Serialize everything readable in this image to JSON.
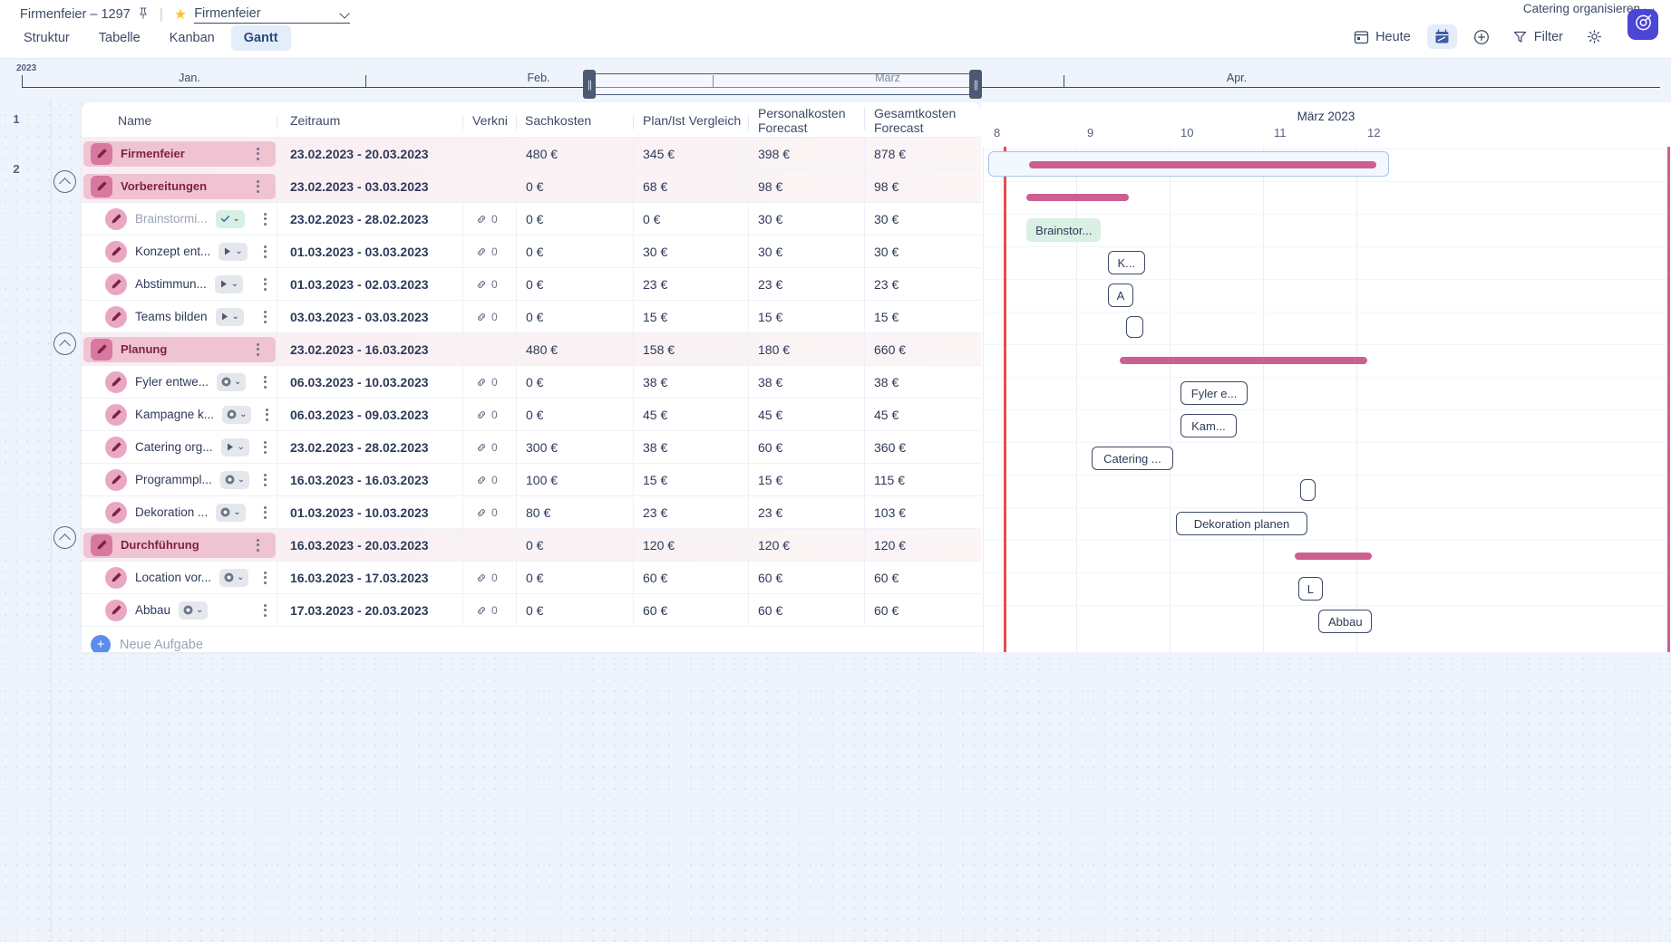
{
  "header": {
    "breadcrumb_project": "Firmenfeier – 1297",
    "pin_icon": "pin-icon",
    "star_icon": "star-icon",
    "project_name": "Firmenfeier",
    "assignee": "Catering organisieren",
    "logo_icon": "target-logo-icon"
  },
  "tabs": [
    {
      "label": "Struktur",
      "active": false
    },
    {
      "label": "Tabelle",
      "active": false
    },
    {
      "label": "Kanban",
      "active": false
    },
    {
      "label": "Gantt",
      "active": true
    }
  ],
  "toolbar": {
    "today_label": "Heute",
    "today_icon": "calendar-icon",
    "calendar_toggle_icon": "calendar-range-icon",
    "add_icon": "plus-circle-icon",
    "filter_label": "Filter",
    "filter_icon": "funnel-icon",
    "settings_icon": "gear-icon"
  },
  "timeline_band": {
    "year": "2023",
    "months": [
      "Jan.",
      "Feb.",
      "März",
      "Apr."
    ],
    "handle_icon": "drag-handle-icon"
  },
  "gutter_numbers": [
    "1",
    "2"
  ],
  "table": {
    "columns": [
      "Name",
      "Zeitraum",
      "Verkni",
      "Sachkosten",
      "Plan/Ist Vergleich",
      "Personalkosten Forecast",
      "Gesamtkosten Forecast"
    ],
    "rows": [
      {
        "name": "Firmenfeier",
        "type": "group",
        "indent": 0,
        "status": null,
        "period": "23.02.2023 - 20.03.2023",
        "links": "",
        "sach": "480 €",
        "plan": "345 €",
        "pers": "398 €",
        "ges": "878 €"
      },
      {
        "name": "Vorbereitungen",
        "type": "group",
        "indent": 0,
        "status": null,
        "period": "23.02.2023 - 03.03.2023",
        "links": "",
        "sach": "0 €",
        "plan": "68 €",
        "pers": "98 €",
        "ges": "98 €"
      },
      {
        "name": "Brainstormi...",
        "type": "task",
        "indent": 1,
        "status": "done",
        "period": "23.02.2023 - 28.02.2023",
        "links": "0",
        "sach": "0 €",
        "plan": "0 €",
        "pers": "30 €",
        "ges": "30 €"
      },
      {
        "name": "Konzept ent...",
        "type": "task",
        "indent": 1,
        "status": "play",
        "period": "01.03.2023 - 03.03.2023",
        "links": "0",
        "sach": "0 €",
        "plan": "30 €",
        "pers": "30 €",
        "ges": "30 €"
      },
      {
        "name": "Abstimmun...",
        "type": "task",
        "indent": 1,
        "status": "play",
        "period": "01.03.2023 - 02.03.2023",
        "links": "0",
        "sach": "0 €",
        "plan": "23 €",
        "pers": "23 €",
        "ges": "23 €"
      },
      {
        "name": "Teams bilden",
        "type": "task",
        "indent": 1,
        "status": "play",
        "period": "03.03.2023 - 03.03.2023",
        "links": "0",
        "sach": "0 €",
        "plan": "15 €",
        "pers": "15 €",
        "ges": "15 €"
      },
      {
        "name": "Planung",
        "type": "group",
        "indent": 0,
        "status": null,
        "period": "23.02.2023 - 16.03.2023",
        "links": "",
        "sach": "480 €",
        "plan": "158 €",
        "pers": "180 €",
        "ges": "660 €"
      },
      {
        "name": "Fyler entwe...",
        "type": "task",
        "indent": 1,
        "status": "dot",
        "period": "06.03.2023 - 10.03.2023",
        "links": "0",
        "sach": "0 €",
        "plan": "38 €",
        "pers": "38 €",
        "ges": "38 €"
      },
      {
        "name": "Kampagne k...",
        "type": "task",
        "indent": 1,
        "status": "dot",
        "period": "06.03.2023 - 09.03.2023",
        "links": "0",
        "sach": "0 €",
        "plan": "45 €",
        "pers": "45 €",
        "ges": "45 €"
      },
      {
        "name": "Catering org...",
        "type": "task",
        "indent": 1,
        "status": "play",
        "period": "23.02.2023 - 28.02.2023",
        "links": "0",
        "sach": "300 €",
        "plan": "38 €",
        "pers": "60 €",
        "ges": "360 €"
      },
      {
        "name": "Programmpl...",
        "type": "task",
        "indent": 1,
        "status": "dot",
        "period": "16.03.2023 - 16.03.2023",
        "links": "0",
        "sach": "100 €",
        "plan": "15 €",
        "pers": "15 €",
        "ges": "115 €"
      },
      {
        "name": "Dekoration ...",
        "type": "task",
        "indent": 1,
        "status": "dot",
        "period": "01.03.2023 - 10.03.2023",
        "links": "0",
        "sach": "80 €",
        "plan": "23 €",
        "pers": "23 €",
        "ges": "103 €"
      },
      {
        "name": "Durchführung",
        "type": "group",
        "indent": 0,
        "status": null,
        "period": "16.03.2023 - 20.03.2023",
        "links": "",
        "sach": "0 €",
        "plan": "120 €",
        "pers": "120 €",
        "ges": "120 €"
      },
      {
        "name": "Location vor...",
        "type": "task",
        "indent": 1,
        "status": "dot",
        "period": "16.03.2023 - 17.03.2023",
        "links": "0",
        "sach": "0 €",
        "plan": "60 €",
        "pers": "60 €",
        "ges": "60 €"
      },
      {
        "name": "Abbau",
        "type": "task",
        "indent": 1,
        "status": "dot",
        "period": "17.03.2023 - 20.03.2023",
        "links": "0",
        "sach": "0 €",
        "plan": "60 €",
        "pers": "60 €",
        "ges": "60 €"
      }
    ],
    "new_task_label": "Neue Aufgabe",
    "new_task_icon": "plus-icon"
  },
  "chart_data": {
    "type": "gantt",
    "title": "März 2023",
    "axis_ticks": [
      "8",
      "9",
      "10",
      "11",
      "12"
    ],
    "bars": [
      {
        "row": 0,
        "label": "",
        "style": "bar",
        "start": 8.38,
        "end": 12.1
      },
      {
        "row": 1,
        "label": "",
        "style": "bar",
        "start": 8.35,
        "end": 9.45
      },
      {
        "row": 2,
        "label": "Brainstor...",
        "style": "pill-green",
        "start": 8.35,
        "end": 9.15
      },
      {
        "row": 3,
        "label": "K...",
        "style": "pill",
        "start": 9.22,
        "end": 9.62
      },
      {
        "row": 4,
        "label": "A",
        "style": "pill",
        "start": 9.22,
        "end": 9.45
      },
      {
        "row": 5,
        "label": "",
        "style": "pill-empty",
        "start": 9.42,
        "end": 9.6
      },
      {
        "row": 6,
        "label": "",
        "style": "bar",
        "start": 9.35,
        "end": 12.0
      },
      {
        "row": 7,
        "label": "Fyler e...",
        "style": "pill",
        "start": 10.0,
        "end": 10.72
      },
      {
        "row": 8,
        "label": "Kam...",
        "style": "pill",
        "start": 10.0,
        "end": 10.6
      },
      {
        "row": 9,
        "label": "Catering ...",
        "style": "pill",
        "start": 9.05,
        "end": 9.92
      },
      {
        "row": 10,
        "label": "",
        "style": "pill-empty",
        "start": 11.28,
        "end": 11.45
      },
      {
        "row": 11,
        "label": "Dekoration planen",
        "style": "pill",
        "start": 9.95,
        "end": 11.36
      },
      {
        "row": 12,
        "label": "",
        "style": "bar",
        "start": 11.22,
        "end": 12.05
      },
      {
        "row": 13,
        "label": "L",
        "style": "pill",
        "start": 11.26,
        "end": 11.5
      },
      {
        "row": 14,
        "label": "Abbau",
        "style": "pill",
        "start": 11.48,
        "end": 12.05
      }
    ],
    "today_marker": "today-line",
    "colors": {
      "bar": "#cb5f90",
      "today_line": "#e0504f",
      "pink_line": "#cf5f92",
      "group_row": "#f0c3d3",
      "accent": "#4c46d6",
      "tab_active_bg": "#e4edfa",
      "done_badge": "#d7f0e3"
    }
  }
}
